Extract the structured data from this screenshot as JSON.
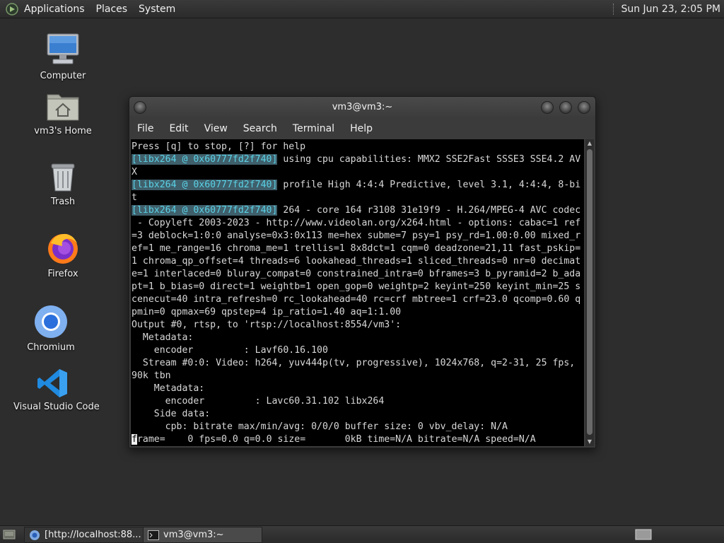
{
  "top_panel": {
    "menus": [
      "Applications",
      "Places",
      "System"
    ],
    "clock": "Sun Jun 23,  2:05 PM"
  },
  "desktop_icons": [
    {
      "label": "Computer",
      "icon": "computer-icon"
    },
    {
      "label": "vm3's Home",
      "icon": "home-folder-icon"
    },
    {
      "label": "Trash",
      "icon": "trash-icon"
    },
    {
      "label": "Firefox",
      "icon": "firefox-icon"
    },
    {
      "label": "Chromium",
      "icon": "chromium-icon"
    },
    {
      "label": "Visual Studio Code",
      "icon": "vscode-icon"
    }
  ],
  "terminal_window": {
    "title": "vm3@vm3:~",
    "menu": [
      "File",
      "Edit",
      "View",
      "Search",
      "Terminal",
      "Help"
    ],
    "lines": [
      [
        {
          "t": "Press [q] to stop, [?] for help"
        }
      ],
      [
        {
          "t": "[libx264 @ 0x60777fd2f740]",
          "hl": true
        },
        {
          "t": " using cpu capabilities: MMX2 SSE2Fast SSSE3 SSE4.2 AV"
        }
      ],
      [
        {
          "t": "X"
        }
      ],
      [
        {
          "t": "[libx264 @ 0x60777fd2f740]",
          "hl": true
        },
        {
          "t": " profile High 4:4:4 Predictive, level 3.1, 4:4:4, 8-bi"
        }
      ],
      [
        {
          "t": "t"
        }
      ],
      [
        {
          "t": "[libx264 @ 0x60777fd2f740]",
          "hl": true
        },
        {
          "t": " 264 - core 164 r3108 31e19f9 - H.264/MPEG-4 AVC codec"
        }
      ],
      [
        {
          "t": " - Copyleft 2003-2023 - http://www.videolan.org/x264.html - options: cabac=1 ref"
        }
      ],
      [
        {
          "t": "=3 deblock=1:0:0 analyse=0x3:0x113 me=hex subme=7 psy=1 psy_rd=1.00:0.00 mixed_r"
        }
      ],
      [
        {
          "t": "ef=1 me_range=16 chroma_me=1 trellis=1 8x8dct=1 cqm=0 deadzone=21,11 fast_pskip="
        }
      ],
      [
        {
          "t": "1 chroma_qp_offset=4 threads=6 lookahead_threads=1 sliced_threads=0 nr=0 decimat"
        }
      ],
      [
        {
          "t": "e=1 interlaced=0 bluray_compat=0 constrained_intra=0 bframes=3 b_pyramid=2 b_ada"
        }
      ],
      [
        {
          "t": "pt=1 b_bias=0 direct=1 weightb=1 open_gop=0 weightp=2 keyint=250 keyint_min=25 s"
        }
      ],
      [
        {
          "t": "cenecut=40 intra_refresh=0 rc_lookahead=40 rc=crf mbtree=1 crf=23.0 qcomp=0.60 q"
        }
      ],
      [
        {
          "t": "pmin=0 qpmax=69 qpstep=4 ip_ratio=1.40 aq=1:1.00"
        }
      ],
      [
        {
          "t": "Output #0, rtsp, to 'rtsp://localhost:8554/vm3':"
        }
      ],
      [
        {
          "t": "  Metadata:"
        }
      ],
      [
        {
          "t": "    encoder         : Lavf60.16.100"
        }
      ],
      [
        {
          "t": "  Stream #0:0: Video: h264, yuv444p(tv, progressive), 1024x768, q=2-31, 25 fps,"
        }
      ],
      [
        {
          "t": "90k tbn"
        }
      ],
      [
        {
          "t": "    Metadata:"
        }
      ],
      [
        {
          "t": "      encoder         : Lavc60.31.102 libx264"
        }
      ],
      [
        {
          "t": "    Side data:"
        }
      ],
      [
        {
          "t": "      cpb: bitrate max/min/avg: 0/0/0 buffer size: 0 vbv_delay: N/A"
        }
      ],
      [
        {
          "t": "f",
          "cursor": true
        },
        {
          "t": "rame=    0 fps=0.0 q=0.0 size=       0kB time=N/A bitrate=N/A speed=N/A"
        }
      ]
    ]
  },
  "taskbar": {
    "items": [
      {
        "label": "[http://localhost:88...",
        "icon": "browser-icon"
      },
      {
        "label": "vm3@vm3:~",
        "icon": "terminal-icon",
        "active": true
      }
    ]
  }
}
